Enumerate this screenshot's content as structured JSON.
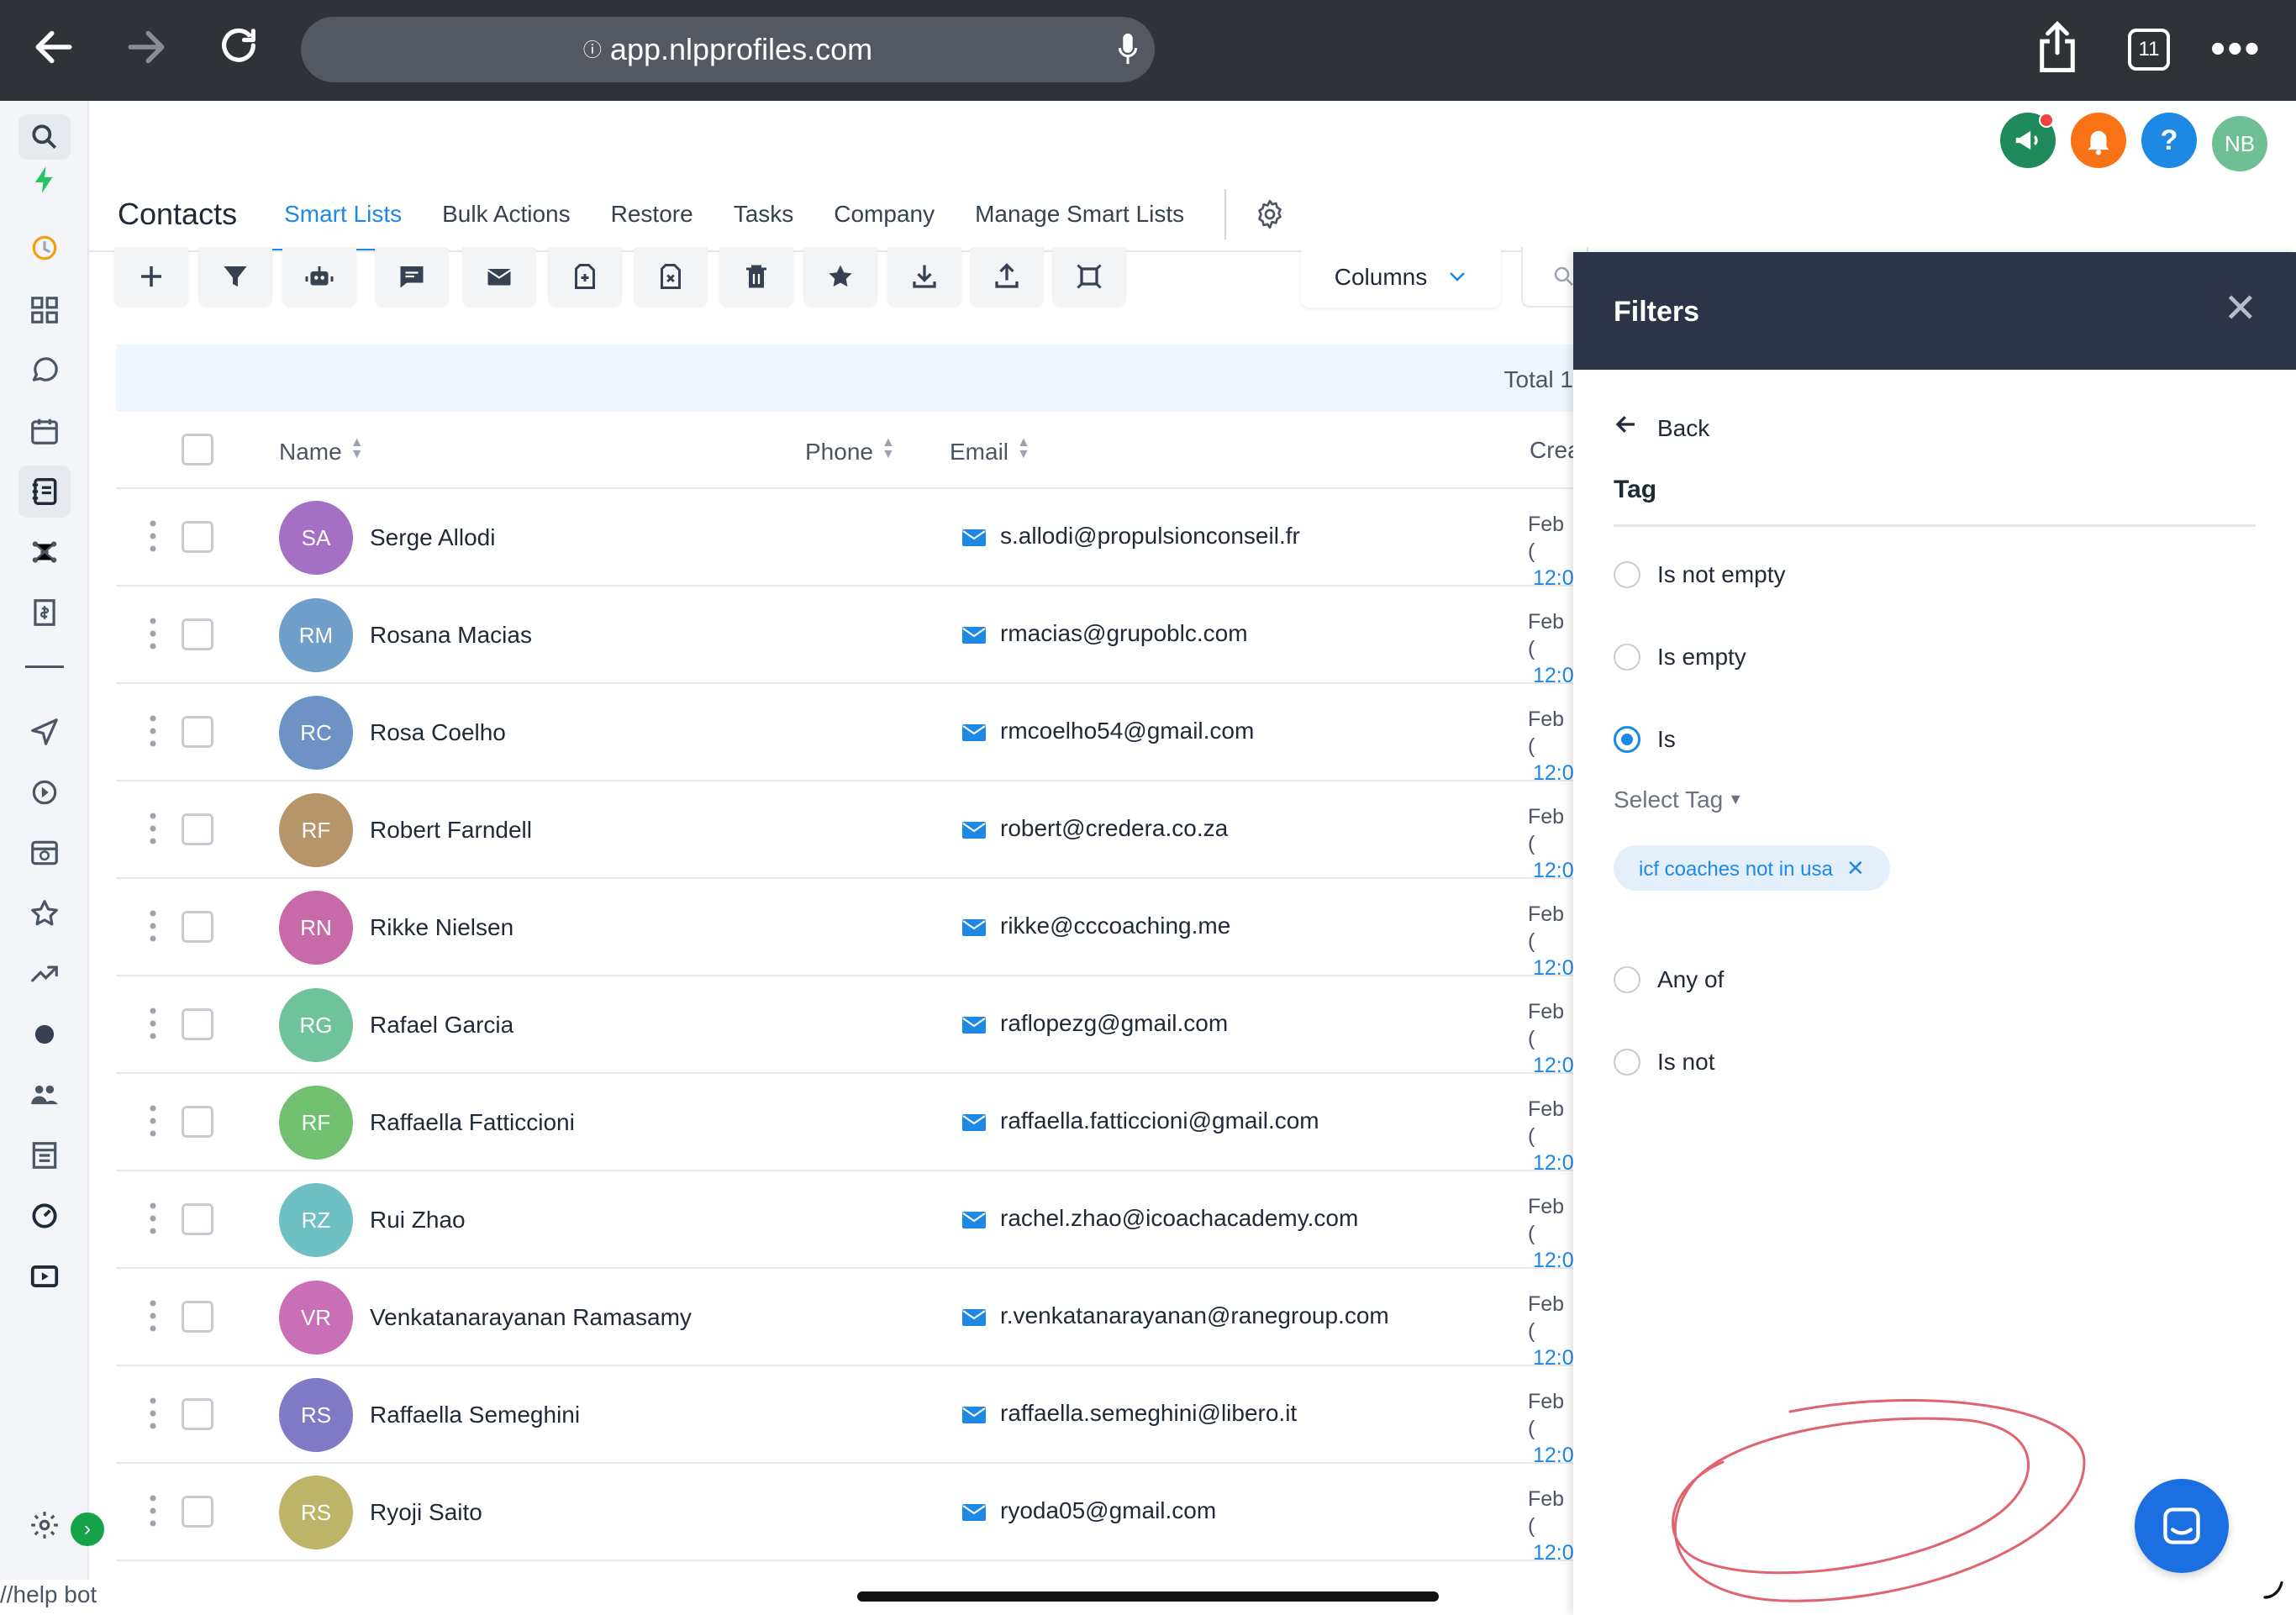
{
  "browser": {
    "url": "app.nlpprofiles.com",
    "tab_count": "11"
  },
  "header": {
    "user_initials": "NB",
    "help_label": "?",
    "colors": {
      "announce": "#1f8a5b",
      "notify": "#f97316",
      "help": "#1e88e5",
      "user": "#6fbf95"
    }
  },
  "nav": {
    "title": "Contacts",
    "tabs": [
      {
        "label": "Smart Lists",
        "active": true
      },
      {
        "label": "Bulk Actions"
      },
      {
        "label": "Restore"
      },
      {
        "label": "Tasks"
      },
      {
        "label": "Company"
      },
      {
        "label": "Manage Smart Lists"
      }
    ]
  },
  "toolbar": {
    "buttons": [
      "plus-icon",
      "filter-icon",
      "robot-icon",
      "message-icon",
      "mail-icon",
      "tag-add-icon",
      "tag-remove-icon",
      "trash-icon",
      "star-icon",
      "download-icon",
      "upload-icon",
      "merge-icon"
    ],
    "columns_label": "Columns"
  },
  "table": {
    "total_label": "Total 1",
    "headers": {
      "name": "Name",
      "phone": "Phone",
      "email": "Email",
      "created": "Crea"
    },
    "rows": [
      {
        "initials": "SA",
        "name": "Serge Allodi",
        "email": "s.allodi@propulsionconseil.fr",
        "date": "Feb (",
        "time": "12:0",
        "color": "#a66fc6"
      },
      {
        "initials": "RM",
        "name": "Rosana Macias",
        "email": "rmacias@grupoblc.com",
        "date": "Feb (",
        "time": "12:0",
        "color": "#6f9ec9"
      },
      {
        "initials": "RC",
        "name": "Rosa Coelho",
        "email": "rmcoelho54@gmail.com",
        "date": "Feb (",
        "time": "12:0",
        "color": "#6f92c6"
      },
      {
        "initials": "RF",
        "name": "Robert Farndell",
        "email": "robert@credera.co.za",
        "date": "Feb (",
        "time": "12:0",
        "color": "#b8946a"
      },
      {
        "initials": "RN",
        "name": "Rikke Nielsen",
        "email": "rikke@cccoaching.me",
        "date": "Feb (",
        "time": "12:0",
        "color": "#c66aa8"
      },
      {
        "initials": "RG",
        "name": "Rafael Garcia",
        "email": "raflopezg@gmail.com",
        "date": "Feb (",
        "time": "12:0",
        "color": "#6fc39a"
      },
      {
        "initials": "RF",
        "name": "Raffaella Fatticcioni",
        "email": "raffaella.fatticcioni@gmail.com",
        "date": "Feb (",
        "time": "12:0",
        "color": "#6fc06f"
      },
      {
        "initials": "RZ",
        "name": "Rui Zhao",
        "email": "rachel.zhao@icoachacademy.com",
        "date": "Feb (",
        "time": "12:0",
        "color": "#6fc0c2"
      },
      {
        "initials": "VR",
        "name": "Venkatanarayanan Ramasamy",
        "email": "r.venkatanarayanan@ranegroup.com",
        "date": "Feb (",
        "time": "12:0",
        "color": "#c86fb8"
      },
      {
        "initials": "RS",
        "name": "Raffaella Semeghini",
        "email": "raffaella.semeghini@libero.it",
        "date": "Feb (",
        "time": "12:0",
        "color": "#7f79c6"
      },
      {
        "initials": "RS",
        "name": "Ryoji Saito",
        "email": "ryoda05@gmail.com",
        "date": "Feb (",
        "time": "12:0",
        "color": "#bdb46a"
      }
    ]
  },
  "filters": {
    "title": "Filters",
    "back_label": "Back",
    "field_label": "Tag",
    "options": [
      {
        "label": "Is not empty",
        "selected": false
      },
      {
        "label": "Is empty",
        "selected": false
      },
      {
        "label": "Is",
        "selected": true
      },
      {
        "label": "Any of",
        "selected": false
      },
      {
        "label": "Is not",
        "selected": false
      }
    ],
    "select_placeholder": "Select Tag",
    "selected_tag": "icf coaches not in usa"
  },
  "footer": {
    "help_bot": "//help bot"
  }
}
